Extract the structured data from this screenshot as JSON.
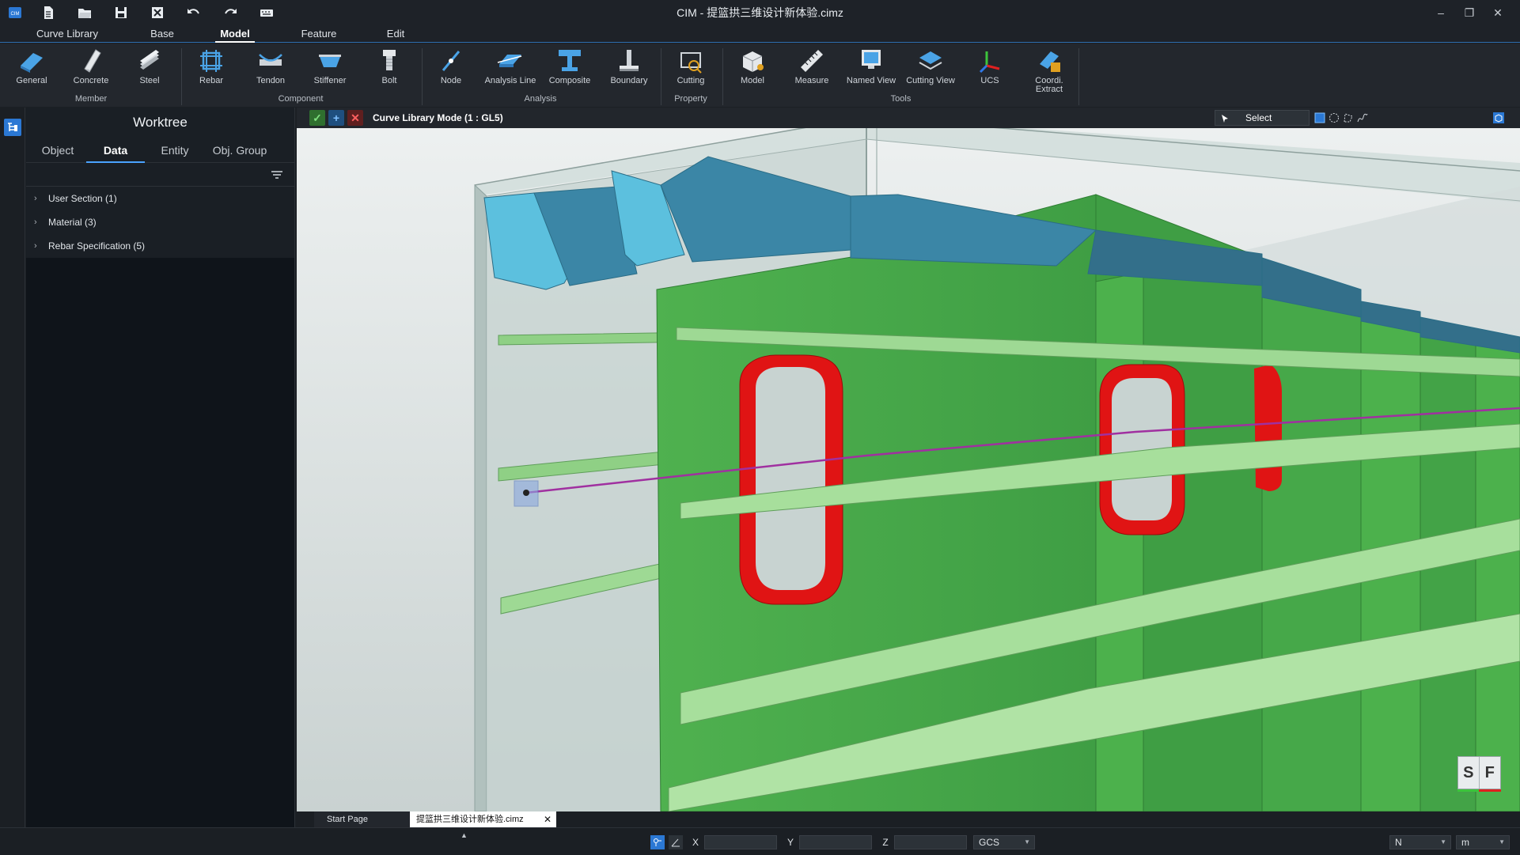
{
  "window": {
    "title": "CIM - 提篮拱三维设计新体验.cimz",
    "quick_access": [
      "app-logo-icon",
      "new-file-icon",
      "open-folder-icon",
      "save-icon",
      "close-file-icon",
      "undo-icon",
      "redo-icon",
      "keyboard-icon"
    ],
    "controls": [
      "minimize-icon",
      "restore-icon",
      "close-icon"
    ]
  },
  "menu": {
    "tabs": [
      {
        "label": "Curve Library"
      },
      {
        "label": "Base"
      },
      {
        "label": "Model",
        "active": true
      },
      {
        "label": "Feature"
      },
      {
        "label": "Edit"
      }
    ]
  },
  "ribbon": {
    "buttons": [
      {
        "label": "General",
        "icon": "general-member-icon"
      },
      {
        "label": "Concrete",
        "icon": "concrete-icon"
      },
      {
        "label": "Steel",
        "icon": "steel-icon"
      },
      {
        "label": "Rebar",
        "icon": "rebar-icon"
      },
      {
        "label": "Tendon",
        "icon": "tendon-icon"
      },
      {
        "label": "Stiffener",
        "icon": "stiffener-icon"
      },
      {
        "label": "Bolt",
        "icon": "bolt-icon"
      },
      {
        "label": "Node",
        "icon": "node-icon"
      },
      {
        "label": "Analysis Line",
        "icon": "analysis-line-icon"
      },
      {
        "label": "Composite",
        "icon": "composite-icon"
      },
      {
        "label": "Boundary",
        "icon": "boundary-icon"
      },
      {
        "label": "Cutting",
        "icon": "cutting-icon"
      },
      {
        "label": "Model",
        "icon": "model-icon"
      },
      {
        "label": "Measure",
        "icon": "measure-icon"
      },
      {
        "label": "Named View",
        "icon": "named-view-icon"
      },
      {
        "label": "Cutting View",
        "icon": "cutting-view-icon"
      },
      {
        "label": "UCS",
        "icon": "ucs-icon"
      },
      {
        "label": "Coordi. Extract",
        "icon": "coordinate-extract-icon"
      }
    ],
    "groups": [
      {
        "label": "Member"
      },
      {
        "label": "Component"
      },
      {
        "label": "Analysis"
      },
      {
        "label": "Property"
      },
      {
        "label": "Tools"
      }
    ]
  },
  "worktree": {
    "title": "Worktree",
    "tabs": [
      {
        "label": "Object"
      },
      {
        "label": "Data",
        "active": true
      },
      {
        "label": "Entity"
      },
      {
        "label": "Obj. Group"
      }
    ],
    "items": [
      {
        "label": "User Section (1)"
      },
      {
        "label": "Material (3)"
      },
      {
        "label": "Rebar Specification (5)"
      }
    ]
  },
  "viewport": {
    "mode_label": "Curve Library Mode (1 : GL5)",
    "select_label": "Select",
    "cube_labels": [
      "S",
      "F"
    ],
    "colors": {
      "shell": "#b9c7c4",
      "web_green": "#4cb14c",
      "web_dark": "#3e9a42",
      "flange_light": "#9bd98f",
      "rib_blue": "#3b86a6",
      "rib_light": "#5cc0de",
      "opening_red": "#e01414",
      "analysis_line": "#a030a0"
    }
  },
  "doc_tabs": [
    {
      "label": "Start Page"
    },
    {
      "label": "提篮拱三维设计新体验.cimz",
      "active": true
    }
  ],
  "statusbar": {
    "coord_labels": [
      "X",
      "Y",
      "Z"
    ],
    "coord_system": "GCS",
    "force_unit": "N",
    "length_unit": "m"
  }
}
